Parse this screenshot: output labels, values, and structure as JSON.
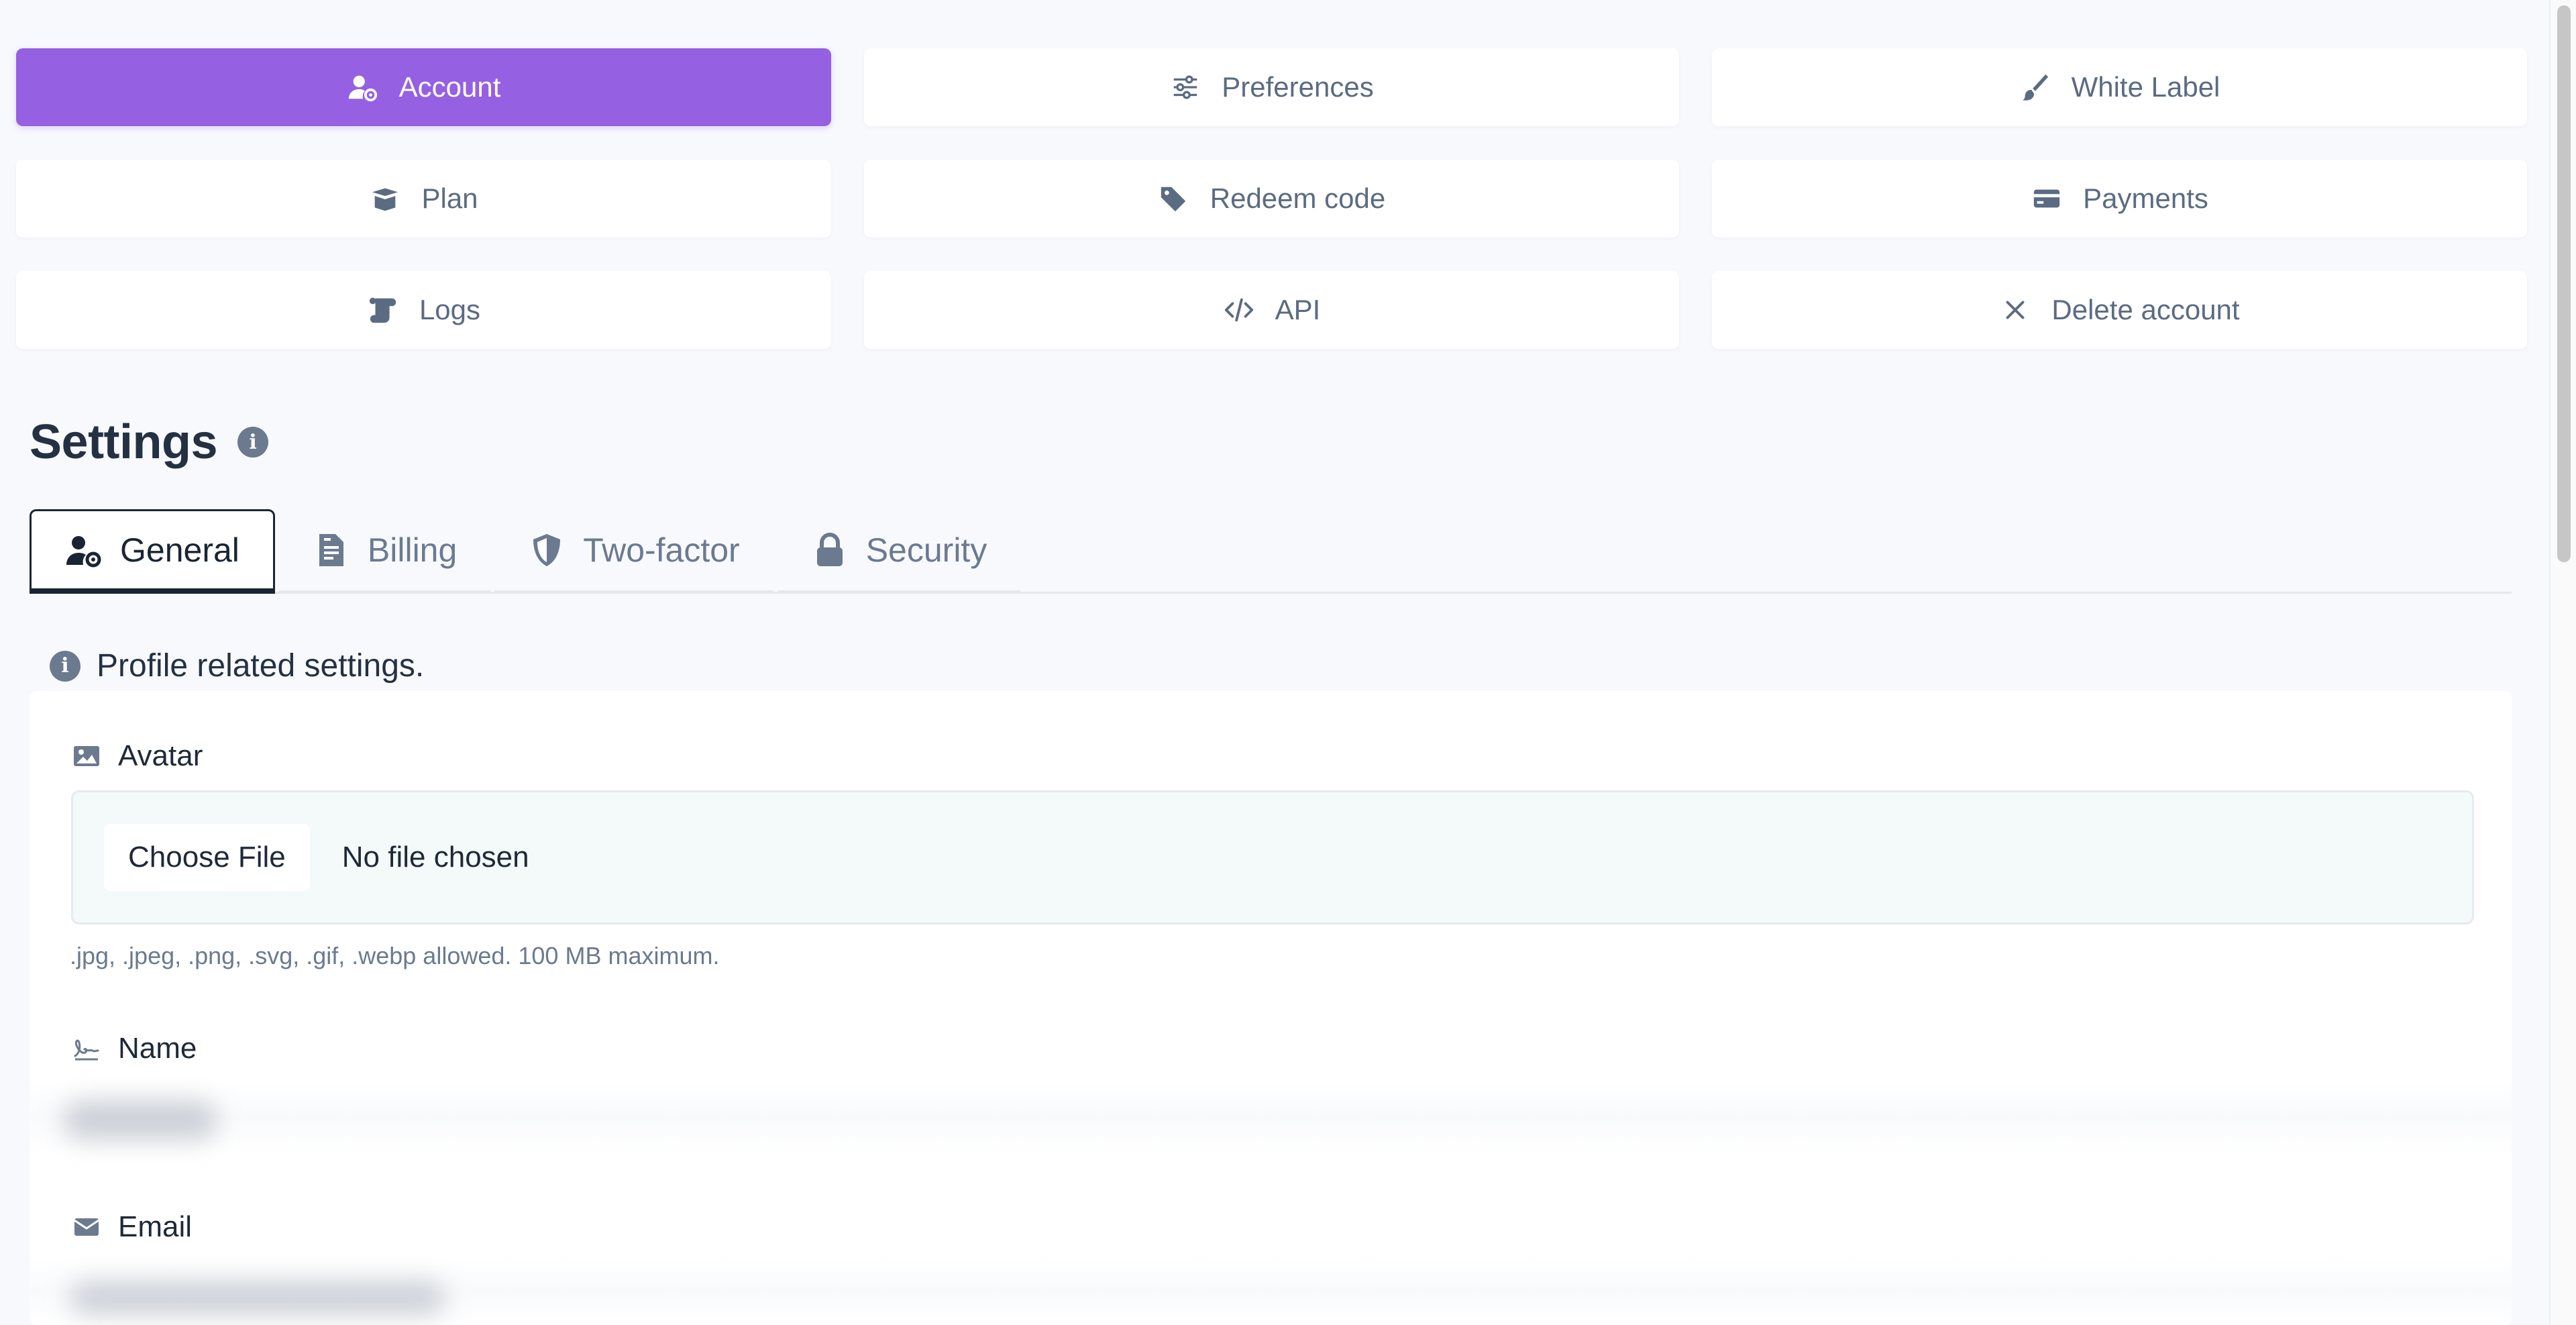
{
  "nav": {
    "buttons": [
      {
        "label": "Account",
        "icon": "user-gear-icon",
        "active": true
      },
      {
        "label": "Preferences",
        "icon": "sliders-icon",
        "active": false
      },
      {
        "label": "White Label",
        "icon": "paintbrush-icon",
        "active": false
      },
      {
        "label": "Plan",
        "icon": "box-open-icon",
        "active": false
      },
      {
        "label": "Redeem code",
        "icon": "tags-icon",
        "active": false
      },
      {
        "label": "Payments",
        "icon": "credit-card-icon",
        "active": false
      },
      {
        "label": "Logs",
        "icon": "scroll-icon",
        "active": false
      },
      {
        "label": "API",
        "icon": "code-icon",
        "active": false
      },
      {
        "label": "Delete account",
        "icon": "close-icon",
        "active": false
      }
    ]
  },
  "settings": {
    "title": "Settings"
  },
  "tabs": [
    {
      "label": "General",
      "icon": "user-gear-icon",
      "active": true
    },
    {
      "label": "Billing",
      "icon": "file-invoice-icon",
      "active": false
    },
    {
      "label": "Two-factor",
      "icon": "shield-icon",
      "active": false
    },
    {
      "label": "Security",
      "icon": "lock-icon",
      "active": false
    }
  ],
  "profile_note": "Profile related settings.",
  "avatar": {
    "label": "Avatar",
    "choose_label": "Choose File",
    "file_status": "No file chosen",
    "hint": ".jpg, .jpeg, .png, .svg, .gif, .webp allowed. 100 MB maximum."
  },
  "name_field": {
    "label": "Name"
  },
  "email_field": {
    "label": "Email"
  },
  "colors": {
    "accent": "#9561e2",
    "background": "#f8f9fd",
    "muted_text": "#5b6b82"
  }
}
